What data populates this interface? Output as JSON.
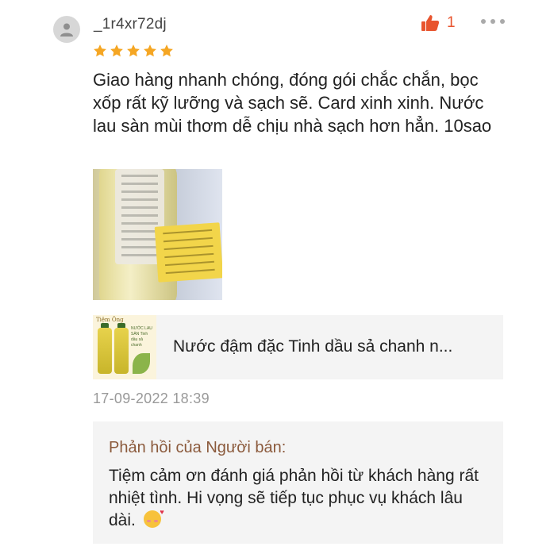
{
  "review": {
    "username": "_1r4xr72dj",
    "rating": 5,
    "likes": "1",
    "text": "Giao hàng nhanh chóng, đóng gói chắc chắn, bọc xốp rất kỹ lưỡng và sạch sẽ. Card xinh xinh. Nước lau sàn mùi thơm dễ chịu nhà sạch hơn hẳn. 10sao",
    "timestamp": "17-09-2022 18:39"
  },
  "product": {
    "name": "Nước đậm đặc Tinh dầu sả chanh n...",
    "thumb_brand": "Tiệm Ông",
    "thumb_text": "NƯỚC LAU SÀN Tinh dầu sả chanh"
  },
  "seller_reply": {
    "title": "Phản hồi của Người bán:",
    "text": "Tiệm cảm ơn đánh giá phản hồi từ khách hàng rất nhiệt tình. Hi vọng sẽ tiếp tục phục vụ khách lâu dài."
  },
  "icons": {
    "avatar": "user-avatar-icon",
    "like": "thumbs-up-icon",
    "more": "more-dots-icon",
    "star": "star-icon",
    "emoji": "smiling-face-with-hearts-emoji"
  },
  "colors": {
    "like": "#e8542e",
    "star": "#f5a623",
    "reply_title": "#8b5a3c",
    "timestamp": "#999999",
    "box_bg": "#f4f4f4"
  }
}
